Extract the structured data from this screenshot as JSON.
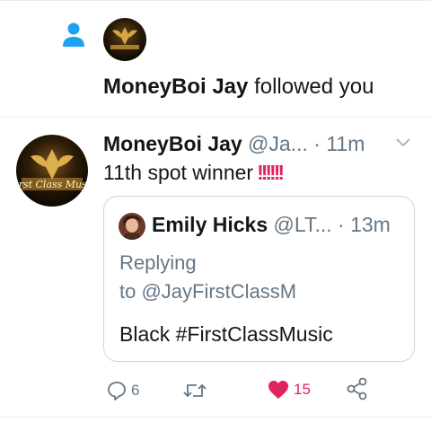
{
  "notification": {
    "actor": "MoneyBoi Jay",
    "action": "followed you"
  },
  "tweet": {
    "name": "MoneyBoi Jay",
    "handle": "@Ja...",
    "dot": "·",
    "time": "11m",
    "text": "11th spot winner",
    "emphasis": "!!!!!!",
    "avatar_caption": "First Class Music"
  },
  "quoted": {
    "name": "Emily Hicks",
    "handle": "@LT...",
    "dot": "·",
    "time": "13m",
    "replying_line1": "Replying",
    "replying_line2": "to @JayFirstClassM",
    "text": "Black #FirstClassMusic"
  },
  "actions": {
    "reply_count": "6",
    "retweet_count": "",
    "like_count": "15"
  },
  "colors": {
    "accent_blue": "#1da1f2",
    "like_red": "#e0245e",
    "muted": "#657786",
    "border": "#ccd6dd"
  },
  "icons": [
    "person-icon",
    "chevron-down-icon",
    "reply-icon",
    "retweet-icon",
    "heart-icon",
    "share-icon"
  ]
}
